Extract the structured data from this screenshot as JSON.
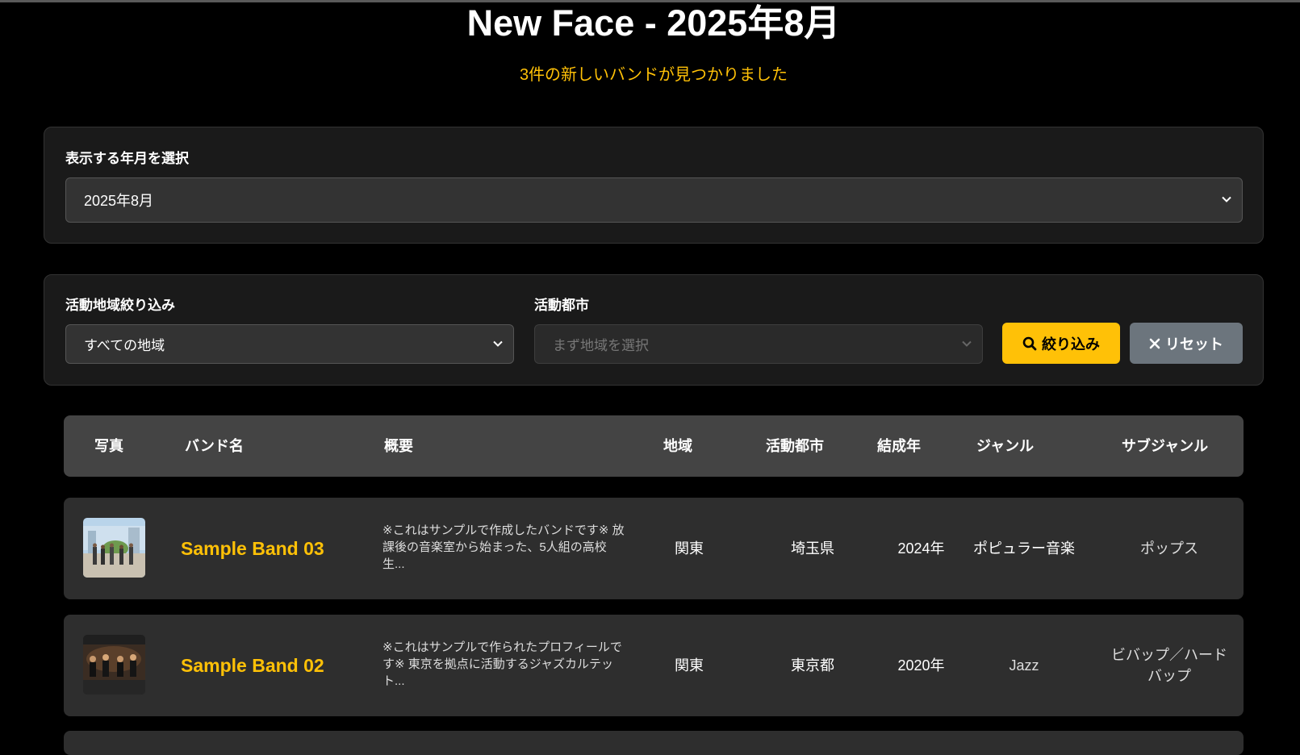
{
  "page": {
    "title": "New Face - 2025年8月",
    "subtitle": "3件の新しいバンドが見つかりました"
  },
  "month_selector": {
    "label": "表示する年月を選択",
    "selected": "2025年8月"
  },
  "filters": {
    "region_label": "活動地域絞り込み",
    "region_selected": "すべての地域",
    "city_label": "活動都市",
    "city_placeholder": "まず地域を選択",
    "filter_button": "絞り込み",
    "reset_button": "リセット"
  },
  "table": {
    "headers": {
      "photo": "写真",
      "band_name": "バンド名",
      "summary": "概要",
      "region": "地域",
      "city": "活動都市",
      "formed": "結成年",
      "genre": "ジャンル",
      "subgenre": "サブジャンル"
    },
    "rows": [
      {
        "name": "Sample Band 03",
        "summary": "※これはサンプルで作成したバンドです※ 放課後の音楽室から始まった、5人組の高校生...",
        "region": "関東",
        "city": "埼玉県",
        "formed": "2024年",
        "genre": "ポピュラー音楽",
        "subgenre": "ポップス"
      },
      {
        "name": "Sample Band 02",
        "summary": "※これはサンプルで作られたプロフィールです※ 東京を拠点に活動するジャズカルテット...",
        "region": "関東",
        "city": "東京都",
        "formed": "2020年",
        "genre": "Jazz",
        "subgenre": "ビバップ／ハードバップ"
      }
    ]
  },
  "colors": {
    "accent": "#ffc107",
    "background": "#000000",
    "panel": "#1a1a1a",
    "row": "#2e2e2e",
    "reset": "#6c757d"
  }
}
